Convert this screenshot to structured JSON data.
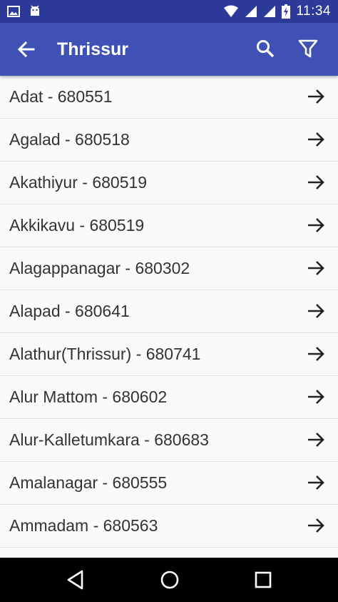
{
  "status_bar": {
    "time": "11:34",
    "icons": [
      "image-notification-icon",
      "android-notification-icon",
      "wifi-icon",
      "signal-icon",
      "signal-icon",
      "battery-charging-icon"
    ]
  },
  "app_bar": {
    "title": "Thrissur",
    "back_icon": "arrow-back-icon",
    "actions": [
      "search-icon",
      "filter-icon"
    ]
  },
  "list": {
    "items": [
      {
        "label": "Adat - 680551"
      },
      {
        "label": "Agalad - 680518"
      },
      {
        "label": "Akathiyur - 680519"
      },
      {
        "label": "Akkikavu - 680519"
      },
      {
        "label": "Alagappanagar - 680302"
      },
      {
        "label": "Alapad - 680641"
      },
      {
        "label": "Alathur(Thrissur) - 680741"
      },
      {
        "label": "Alur Mattom - 680602"
      },
      {
        "label": "Alur-Kalletumkara - 680683"
      },
      {
        "label": "Amalanagar - 680555"
      },
      {
        "label": "Ammadam - 680563"
      }
    ]
  },
  "nav_bar": {
    "icons": [
      "back-triangle-icon",
      "home-circle-icon",
      "recents-square-icon"
    ]
  },
  "colors": {
    "status_bar": "#2d3a9a",
    "app_bar": "#3f51b5",
    "list_background": "#fafafa",
    "divider": "#dedede",
    "text": "#333333",
    "nav_bar": "#000000"
  }
}
